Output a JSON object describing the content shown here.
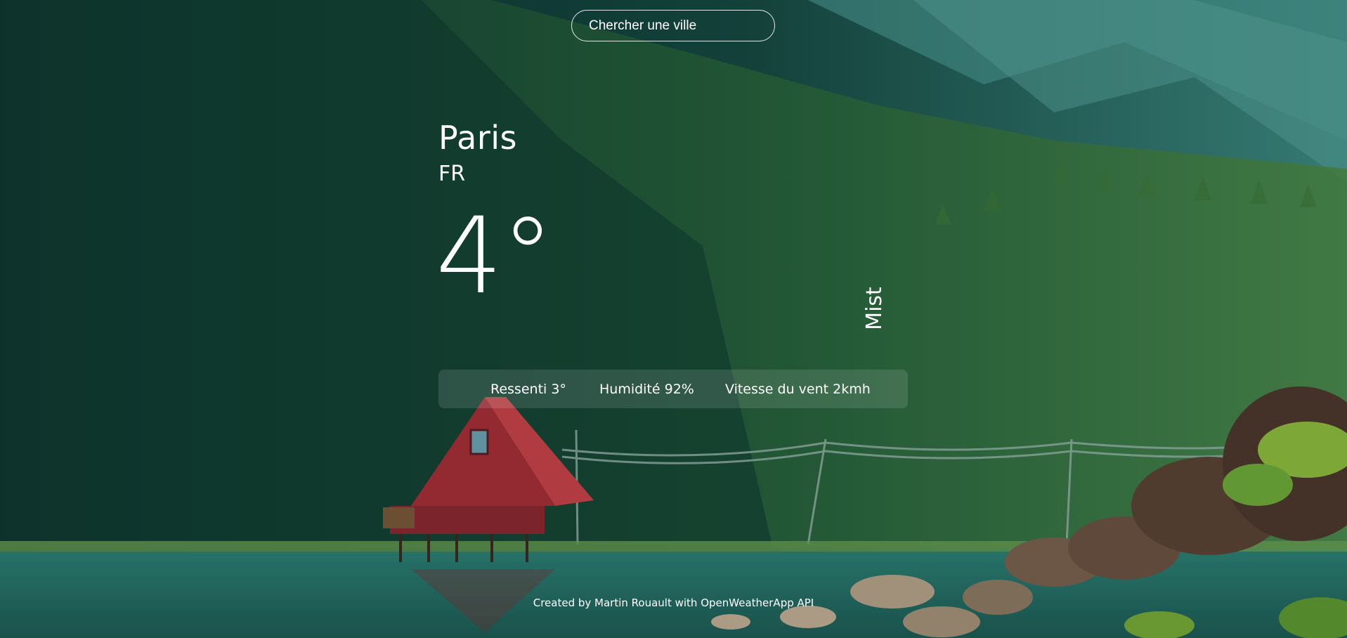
{
  "search": {
    "placeholder": "Chercher une ville"
  },
  "weather": {
    "city": "Paris",
    "country": "FR",
    "temperature": "4°",
    "condition": "Mist"
  },
  "details": {
    "feels_like": "Ressenti 3°",
    "humidity": "Humidité 92%",
    "wind": "Vitesse du vent 2kmh"
  },
  "footer": {
    "credit": "Created by Martin Rouault with OpenWeatherApp API"
  },
  "colors": {
    "text": "#ffffff",
    "forest_dark": "#0e3a36",
    "forest_light": "#3f7a3c",
    "lake": "#2c7a6e",
    "cabin_red": "#b3343a"
  }
}
